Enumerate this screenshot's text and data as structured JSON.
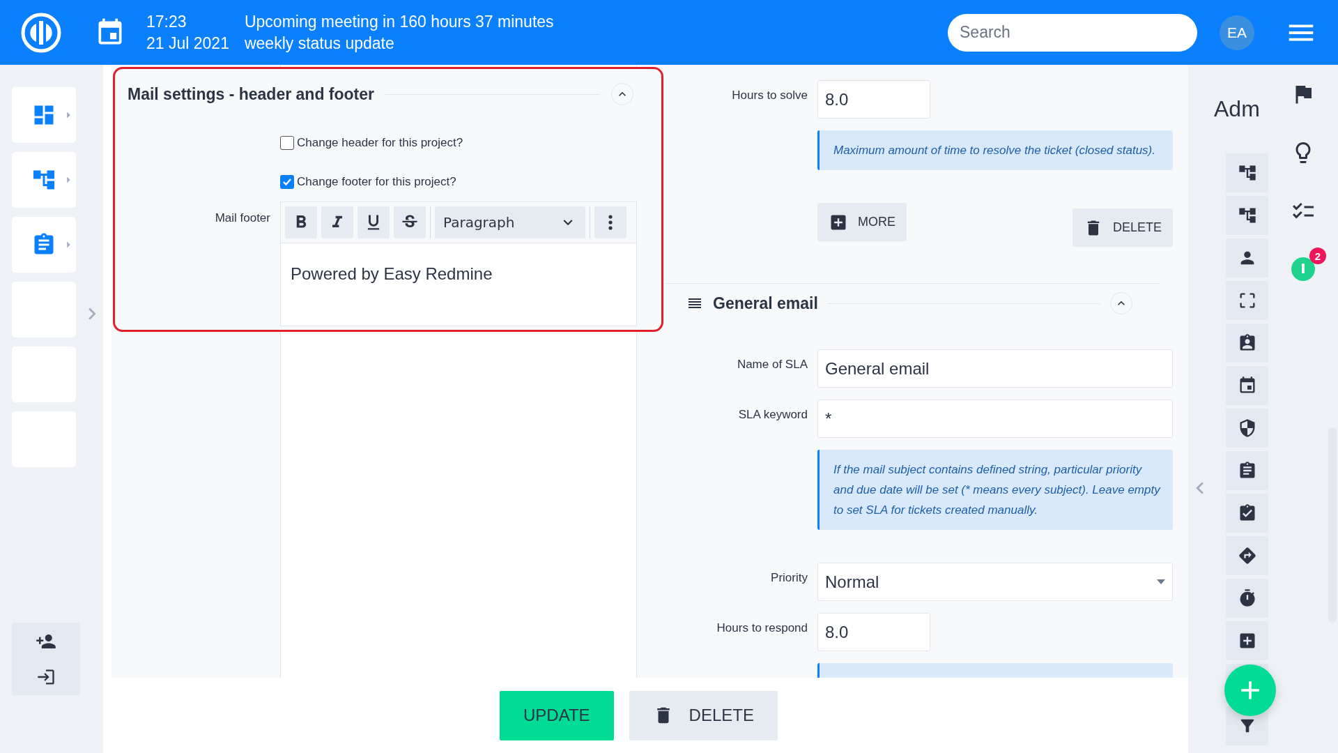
{
  "top_bar": {
    "time": "17:23",
    "meeting": "Upcoming meeting in 160 hours 37 minutes",
    "date": "21 Jul 2021",
    "meeting_title": "weekly status update",
    "search": {
      "placeholder": "Search"
    },
    "avatar": "EA"
  },
  "mail_settings": {
    "title": "Mail settings - header and footer",
    "expanded": true,
    "options": [
      {
        "label": "Change header for this project?",
        "checked": false
      },
      {
        "label": "Change footer for this project?",
        "checked": true
      }
    ],
    "footer_label": "Mail footer",
    "block_format": "Paragraph",
    "content": "Powered by Easy Redmine"
  },
  "sla": {
    "fields": [
      {
        "kind": "short",
        "label": "Hours to solve",
        "value": "8.0"
      },
      {
        "kind": "hint",
        "text": "Maximum amount of time to resolve the ticket (closed status)."
      }
    ],
    "more_button": "MORE",
    "delete_button": "DELETE"
  },
  "general_email": {
    "title": "General email",
    "expanded": true,
    "fields": [
      {
        "kind": "text",
        "label": "Name of SLA",
        "value": "General email"
      },
      {
        "kind": "text",
        "label": "SLA keyword",
        "value": "*"
      },
      {
        "kind": "hint",
        "text": "If the mail subject contains defined string, particular priority and due date will be set (* means every subject). Leave empty to set SLA for tickets created manually."
      },
      {
        "kind": "select",
        "label": "Priority",
        "value": "Normal"
      },
      {
        "kind": "short",
        "label": "Hours to respond",
        "value": "8.0"
      },
      {
        "kind": "hint"
      }
    ]
  },
  "actions": [
    {
      "kind": "primary",
      "label": "UPDATE"
    },
    {
      "kind": "delete",
      "label": "DELETE"
    }
  ],
  "right_panel": {
    "title": "Adm",
    "timer_badge": "2"
  }
}
